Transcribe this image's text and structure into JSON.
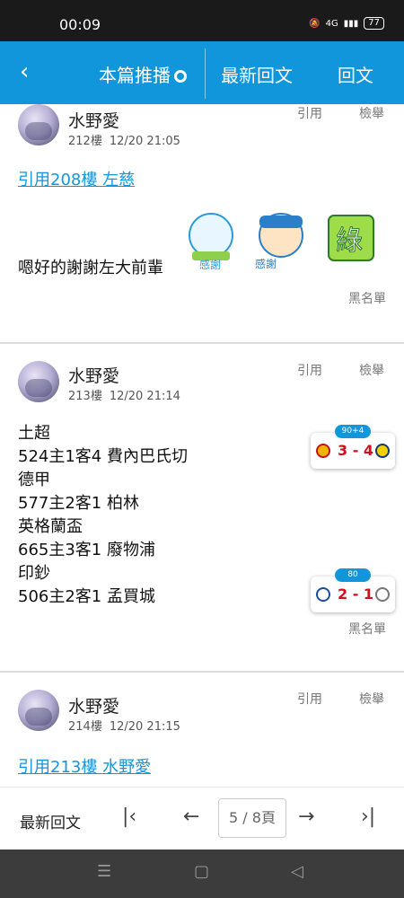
{
  "status": {
    "time": "00:09",
    "net": "4G",
    "battery": "77"
  },
  "topbar": {
    "tab_push": "本篇推播",
    "tab_latest": "最新回文",
    "tab_reply": "回文"
  },
  "posts": [
    {
      "name": "水野愛",
      "floor": "212樓",
      "time": "12/20 21:05",
      "quote_label": "引用",
      "report_label": "檢舉",
      "quote_link": "引用208樓 左慈",
      "body": "嗯好的謝謝左大前輩",
      "blacklist": "黑名單",
      "stickers": [
        {
          "text": "感謝"
        },
        {
          "text": "感謝"
        },
        {
          "text": "綠"
        }
      ]
    },
    {
      "name": "水野愛",
      "floor": "213樓",
      "time": "12/20 21:14",
      "quote_label": "引用",
      "report_label": "檢舉",
      "body": "土超\n524主1客4 費內巴氏切\n德甲\n577主2客1 柏林\n英格蘭盃\n665主3客1 廢物浦\n印鈔\n506主2客1 孟買城",
      "blacklist": "黑名單",
      "scores": [
        {
          "badge": "90+4",
          "result": "3 - 4"
        },
        {
          "badge": "80",
          "result": "2 - 1"
        }
      ]
    },
    {
      "name": "水野愛",
      "floor": "214樓",
      "time": "12/20 21:15",
      "quote_label": "引用",
      "report_label": "檢舉",
      "quote_link": "引用213樓 水野愛"
    }
  ],
  "pager": {
    "latest": "最新回文",
    "page": "5 / 8頁"
  }
}
